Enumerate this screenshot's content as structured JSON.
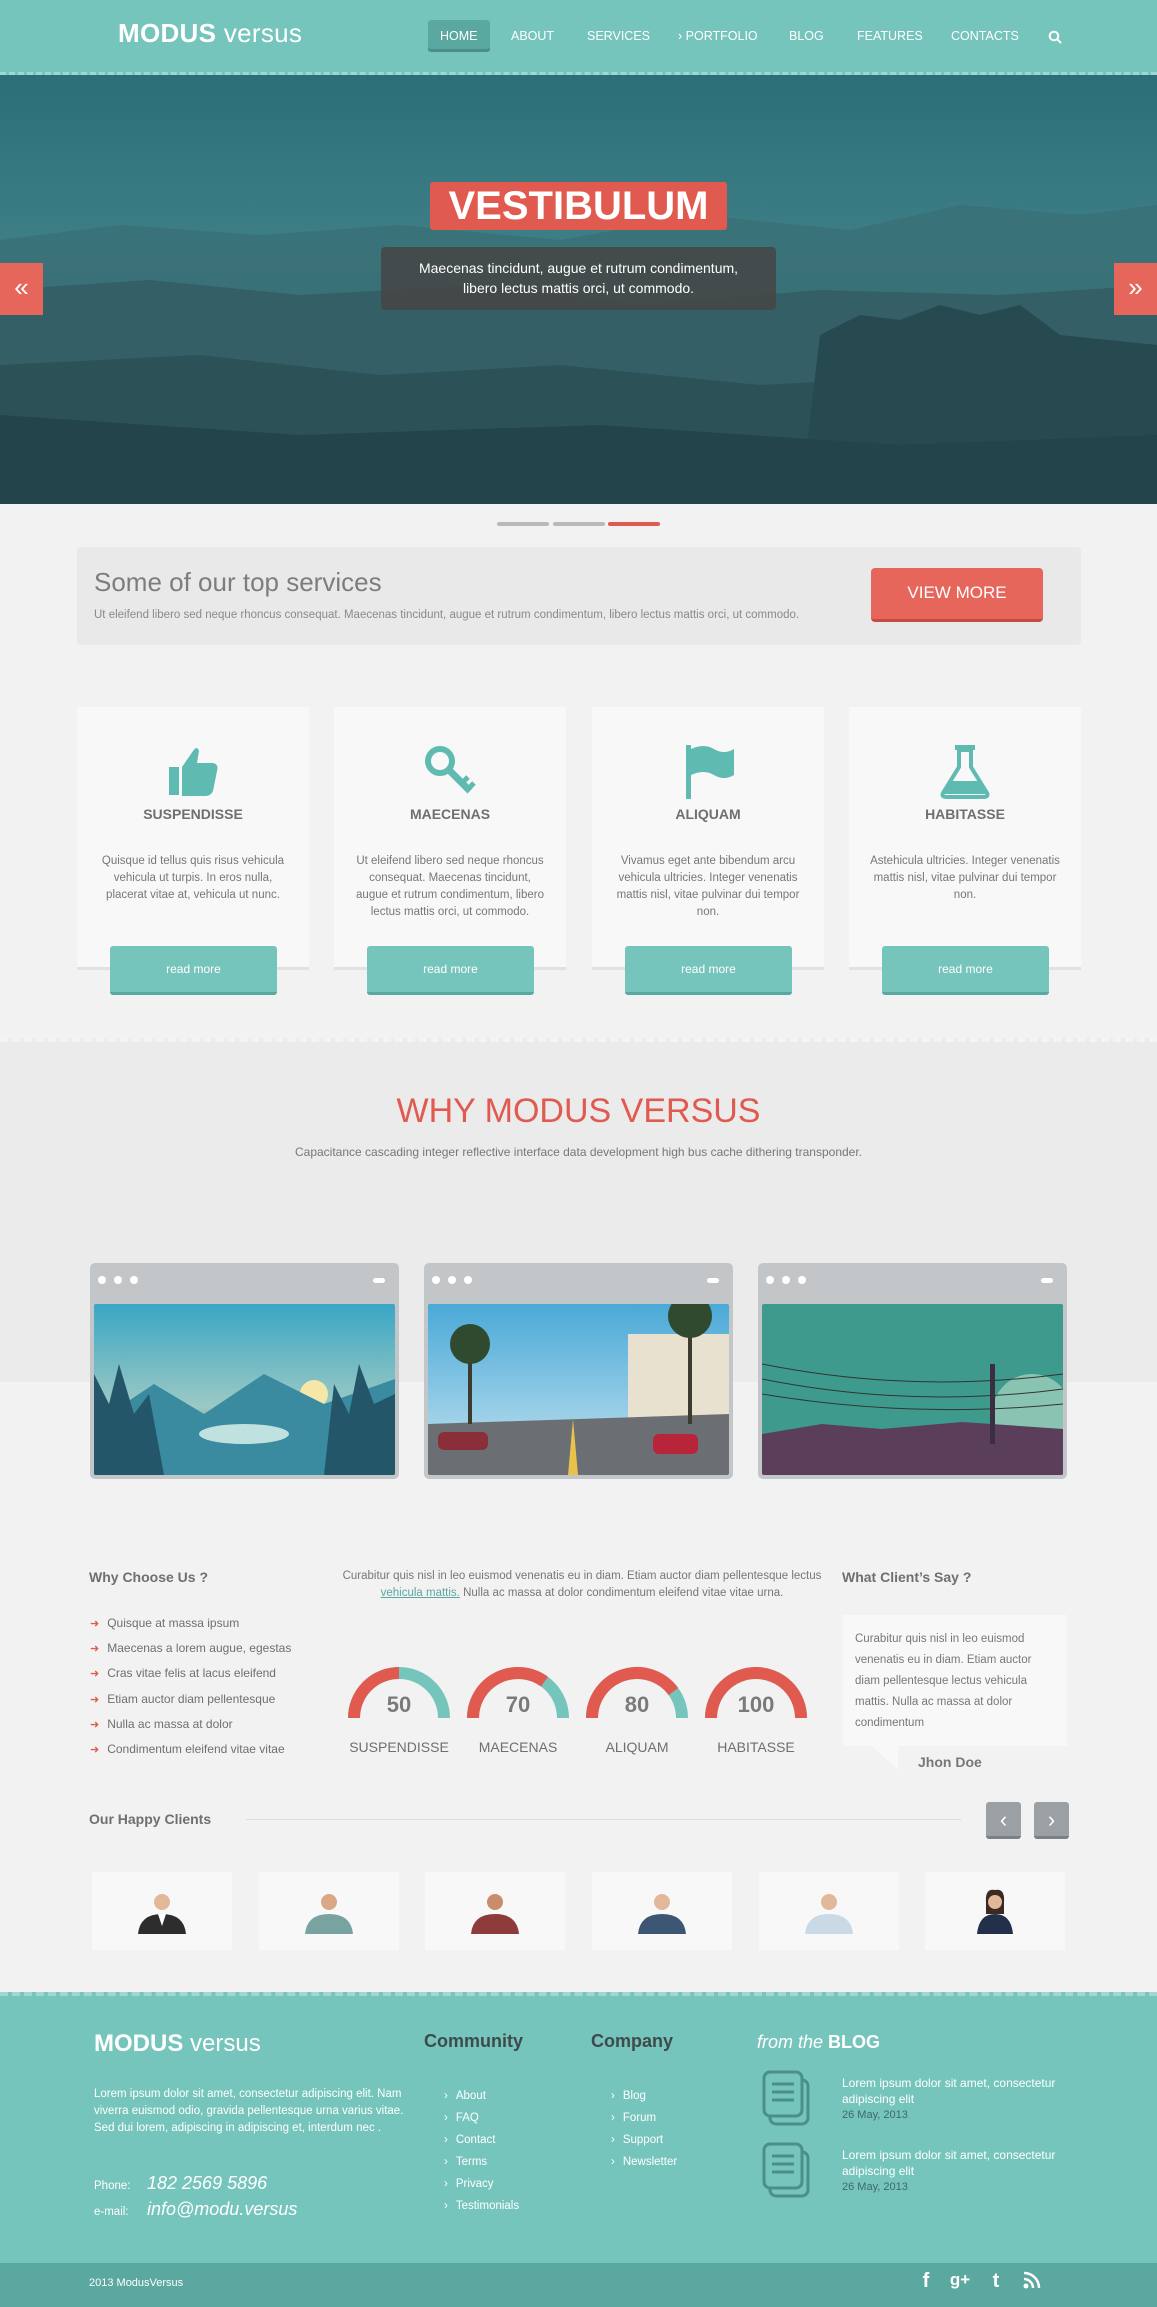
{
  "header": {
    "logo_bold": "MODUS",
    "logo_light": "versus",
    "nav": [
      "HOME",
      "ABOUT",
      "SERVICES",
      "PORTFOLIO",
      "BLOG",
      "FEATURES",
      "CONTACTS"
    ]
  },
  "hero": {
    "title": "VESTIBULUM",
    "subtitle_line1": "Maecenas tincidunt, augue et rutrum condimentum,",
    "subtitle_line2": "libero lectus mattis orci, ut commodo.",
    "prev": "«",
    "next": "»",
    "active_slide": 3,
    "slides": 3
  },
  "services_banner": {
    "title": "Some of our top services",
    "text": "Ut eleifend libero sed neque rhoncus consequat. Maecenas tincidunt, augue et rutrum condimentum, libero lectus mattis orci, ut commodo.",
    "button": "VIEW MORE"
  },
  "cards": [
    {
      "icon": "thumbs-up-icon",
      "title": "SUSPENDISSE",
      "text": "Quisque id tellus quis risus vehicula vehicula ut turpis. In eros nulla, placerat vitae at, vehicula ut nunc.",
      "button": "read more"
    },
    {
      "icon": "key-icon",
      "title": "MAECENAS",
      "text": "Ut eleifend libero sed neque rhoncus consequat. Maecenas tincidunt, augue et rutrum condimentum, libero lectus mattis orci, ut commodo.",
      "button": "read more"
    },
    {
      "icon": "flag-icon",
      "title": "ALIQUAM",
      "text": "Vivamus eget ante bibendum arcu vehicula ultricies. Integer venenatis mattis nisl, vitae pulvinar dui tempor non.",
      "button": "read more"
    },
    {
      "icon": "flask-icon",
      "title": "HABITASSE",
      "text": "Astehicula ultricies. Integer venenatis mattis nisl, vitae pulvinar dui tempor non.",
      "button": "read more"
    }
  ],
  "why": {
    "title": "WHY MODUS VERSUS",
    "subtitle": "Capacitance cascading integer reflective interface data development high bus cache dithering transponder."
  },
  "why_choose": {
    "heading": "Why Choose Us ?",
    "items": [
      "Quisque at massa ipsum",
      "Maecenas a lorem augue, egestas",
      "Cras vitae felis at lacus eleifend",
      "Etiam auctor diam pellentesque",
      "Nulla ac massa at dolor",
      "Condimentum eleifend vitae vitae"
    ]
  },
  "stats": {
    "text_before": "Curabitur quis nisl in leo euismod venenatis eu in diam. Etiam auctor diam pellentesque lectus",
    "link": "vehicula mattis.",
    "text_after": "Nulla ac massa at dolor condimentum eleifend vitae vitae urna.",
    "gauges": [
      {
        "value": "50",
        "label": "SUSPENDISSE",
        "fraction": 0.5
      },
      {
        "value": "70",
        "label": "MAECENAS",
        "fraction": 0.7
      },
      {
        "value": "80",
        "label": "ALIQUAM",
        "fraction": 0.8
      },
      {
        "value": "100",
        "label": "HABITASSE",
        "fraction": 1.0
      }
    ]
  },
  "testimonial": {
    "heading": "What Client’s Say ?",
    "text": "Curabitur quis nisl in leo euismod venenatis eu in diam. Etiam auctor diam pellentesque lectus vehicula mattis. Nulla ac massa at dolor condimentum",
    "author": "Jhon Doe"
  },
  "clients": {
    "heading": "Our Happy Clients",
    "prev": "‹",
    "next": "›"
  },
  "footer": {
    "logo_bold": "MODUS",
    "logo_light": "versus",
    "about": "Lorem ipsum dolor sit amet, consectetur adipiscing elit. Nam viverra euismod odio, gravida pellentesque urna varius vitae. Sed dui lorem, adipiscing in adipiscing et, interdum nec .",
    "phone_label": "Phone:",
    "phone": "182 2569 5896",
    "email_label": "e-mail:",
    "email": "info@modu.versus",
    "community_heading": "Community",
    "community_links": [
      "About",
      "FAQ",
      "Contact",
      "Terms",
      "Privacy",
      "Testimonials"
    ],
    "company_heading": "Company",
    "company_links": [
      "Blog",
      "Forum",
      "Support",
      "Newsletter"
    ],
    "blog_heading_prefix": "from the",
    "blog_heading": "BLOG",
    "blog_posts": [
      {
        "title": "Lorem ipsum dolor sit amet, consectetur adipiscing elit",
        "date": "26 May, 2013"
      },
      {
        "title": "Lorem ipsum dolor sit amet, consectetur adipiscing elit",
        "date": "26 May, 2013"
      }
    ],
    "copyright": "2013 ModusVersus"
  },
  "colors": {
    "teal": "#76c5bc",
    "red": "#e05a4f",
    "gray": "#6f6f6f"
  }
}
